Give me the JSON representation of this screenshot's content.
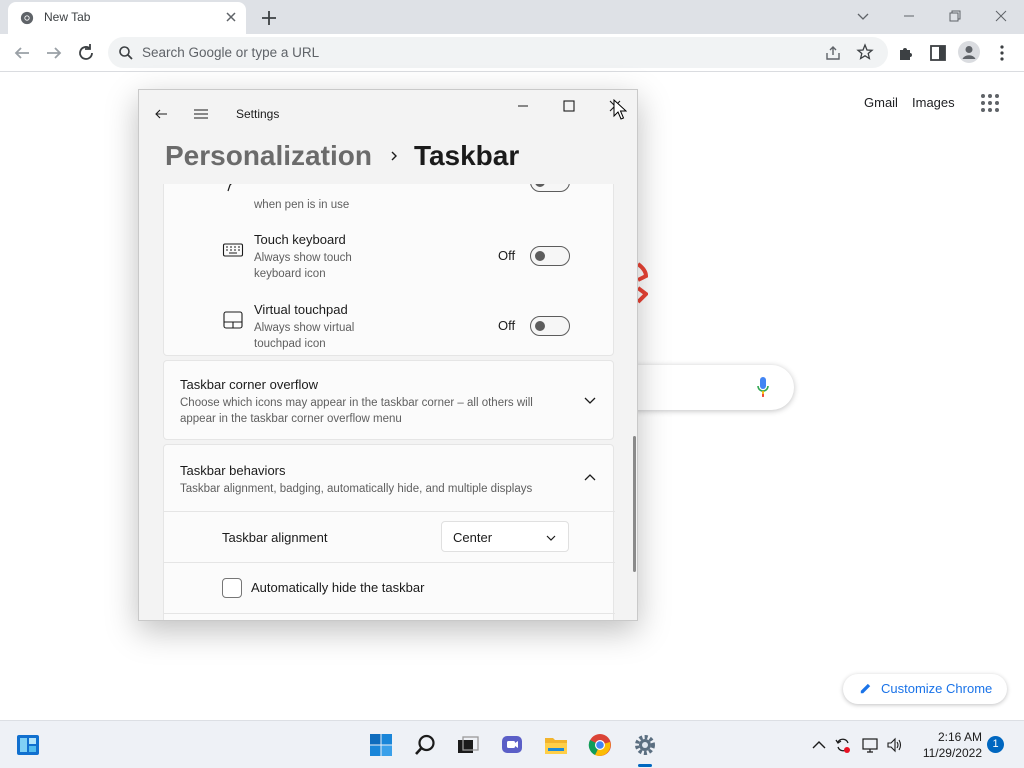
{
  "browser": {
    "tab": {
      "title": "New Tab"
    },
    "omnibox": {
      "placeholder": "Search Google or type a URL"
    }
  },
  "ntp": {
    "links": [
      "Gmail",
      "Images"
    ],
    "customize_label": "Customize Chrome"
  },
  "settings": {
    "window_title": "Settings",
    "breadcrumb": {
      "parent": "Personalization",
      "current": "Taskbar"
    },
    "pen_item": {
      "desc": "when pen is in use"
    },
    "corner_icons": [
      {
        "title": "Touch keyboard",
        "desc": "Always show touch keyboard icon",
        "state": "Off",
        "icon": "keyboard-icon"
      },
      {
        "title": "Virtual touchpad",
        "desc": "Always show virtual touchpad icon",
        "state": "Off",
        "icon": "touchpad-icon"
      }
    ],
    "corner_overflow": {
      "title": "Taskbar corner overflow",
      "desc": "Choose which icons may appear in the taskbar corner – all others will appear in the taskbar corner overflow menu"
    },
    "behaviors": {
      "title": "Taskbar behaviors",
      "desc": "Taskbar alignment, badging, automatically hide, and multiple displays",
      "alignment_label": "Taskbar alignment",
      "alignment_value": "Center",
      "autohide_label": "Automatically hide the taskbar",
      "autohide_checked": false
    }
  },
  "taskbar": {
    "apps": [
      "widgets-icon",
      "start-icon",
      "search-icon",
      "task-view-icon",
      "chat-icon",
      "file-explorer-icon",
      "chrome-icon",
      "settings-icon"
    ],
    "time": "2:16 AM",
    "date": "11/29/2022",
    "notification_count": "1"
  },
  "colors": {
    "accent": "#0067c0",
    "link": "#1a73e8"
  }
}
